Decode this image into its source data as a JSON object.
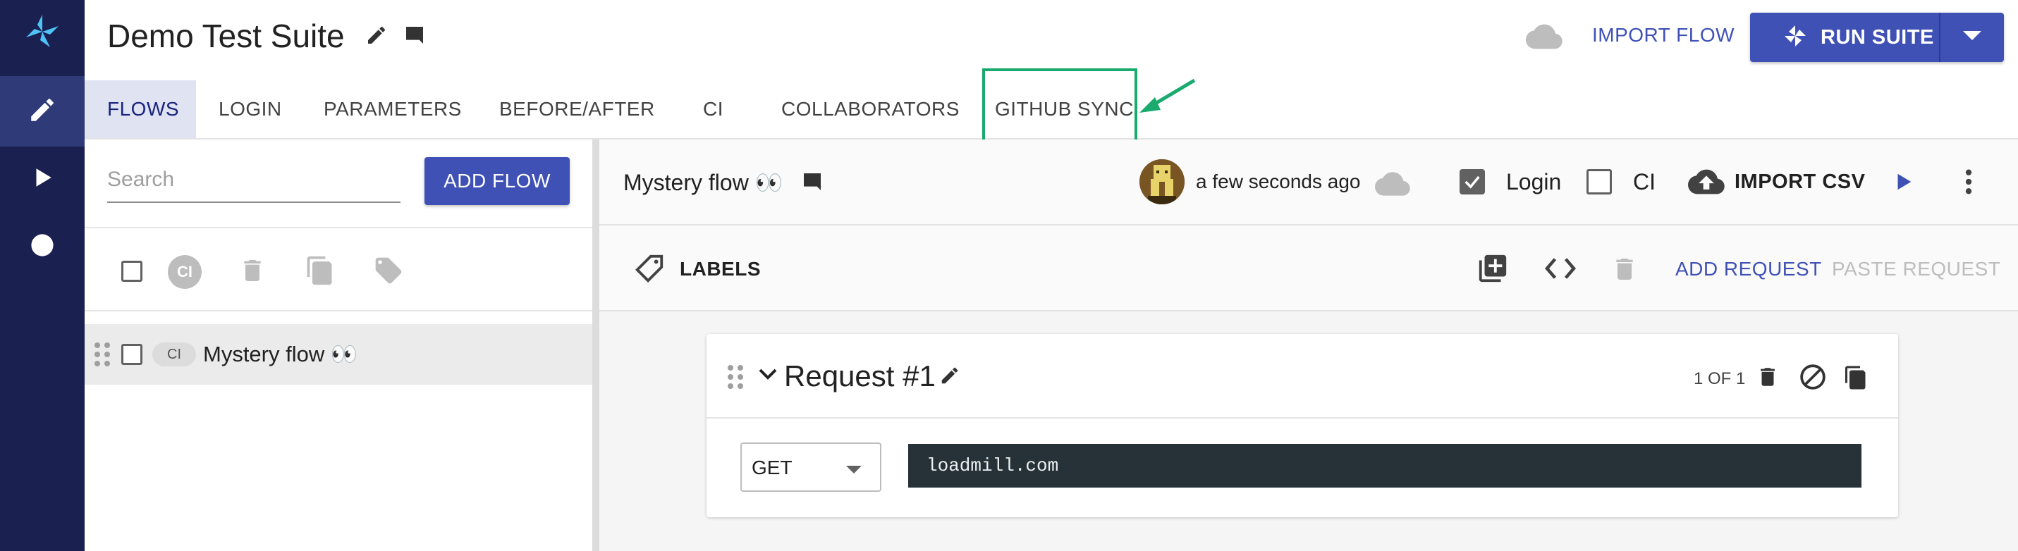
{
  "sidebar": {
    "logo": "loadmill-logo-icon",
    "items": [
      {
        "icon": "pencil-icon",
        "active": true
      },
      {
        "icon": "play-icon",
        "active": false
      },
      {
        "icon": "dot-icon",
        "active": false
      }
    ]
  },
  "header": {
    "suite_title": "Demo Test Suite",
    "import_flow_label": "IMPORT FLOW",
    "run_suite_label": "RUN SUITE"
  },
  "tabs": [
    {
      "label": "FLOWS",
      "active": true
    },
    {
      "label": "LOGIN",
      "active": false
    },
    {
      "label": "PARAMETERS",
      "active": false
    },
    {
      "label": "BEFORE/AFTER",
      "active": false
    },
    {
      "label": "CI",
      "active": false
    },
    {
      "label": "COLLABORATORS",
      "active": false
    },
    {
      "label": "GITHUB SYNC",
      "active": false,
      "highlighted": true
    }
  ],
  "colors": {
    "sidebar_bg": "#1a2151",
    "primary": "#3f51b5",
    "highlight": "#1aaa6e",
    "code_bg": "#263238"
  },
  "left_panel": {
    "search_placeholder": "Search",
    "add_flow_label": "ADD FLOW",
    "toolbar": {
      "ci_label": "CI"
    },
    "flows": [
      {
        "ci_label": "CI",
        "name": "Mystery flow 👀",
        "checked": false
      }
    ]
  },
  "right_panel": {
    "flow_title": "Mystery flow 👀",
    "last_saved": "a few seconds ago",
    "login_label": "Login",
    "login_checked": true,
    "ci_label": "CI",
    "ci_checked": false,
    "import_csv_label": "IMPORT CSV",
    "labels_label": "LABELS",
    "add_request_label": "ADD REQUEST",
    "paste_request_label": "PASTE REQUEST",
    "request": {
      "title": "Request #1",
      "count": "1 OF 1",
      "method": "GET",
      "url": "loadmill.com"
    }
  }
}
